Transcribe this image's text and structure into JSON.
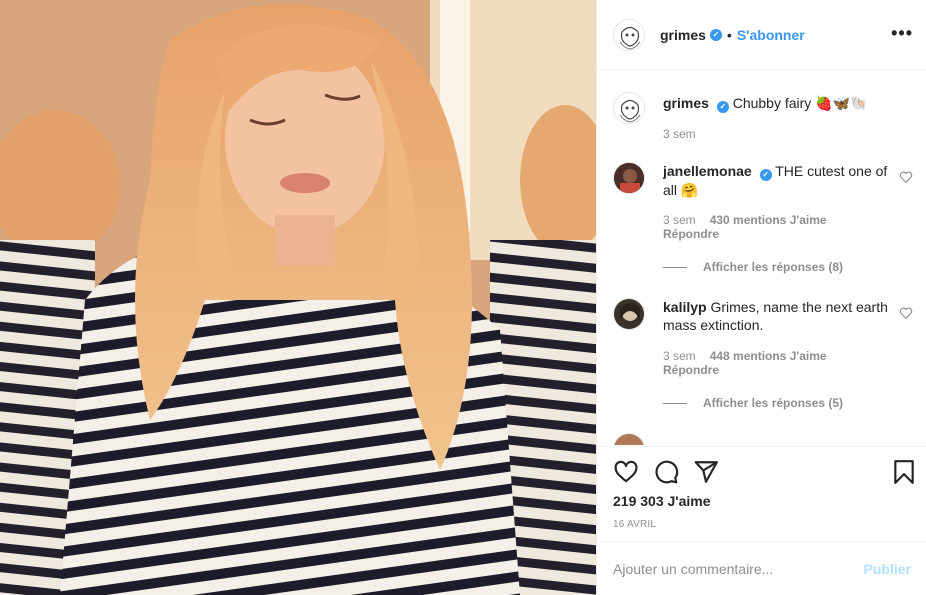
{
  "post": {
    "username": "grimes",
    "follow_label": "S'abonner",
    "separator": "•",
    "more_label": "•••"
  },
  "caption": {
    "username": "grimes",
    "text": "Chubby fairy 🍓🦋🐚",
    "time": "3 sem"
  },
  "comments": [
    {
      "username": "janellemonae",
      "verified": true,
      "text": "THE cutest one of all 🤗",
      "time": "3 sem",
      "likes": "430 mentions J'aime",
      "reply": "Répondre",
      "view_replies": "Afficher les réponses (8)"
    },
    {
      "username": "kalilyp",
      "verified": false,
      "text": "Grimes, name the next earth mass extinction.",
      "time": "3 sem",
      "likes": "448 mentions J'aime",
      "reply": "Répondre",
      "view_replies": "Afficher les réponses (5)"
    }
  ],
  "stats": {
    "likes": "219 303 J'aime",
    "date": "16 AVRIL"
  },
  "composer": {
    "placeholder": "Ajouter un commentaire...",
    "publish_label": "Publier"
  },
  "colors": {
    "accent": "#3897f0",
    "publish_disabled": "#b2dffc",
    "muted": "#8e8e8e"
  },
  "icons": {
    "like": "heart-icon",
    "comment": "comment-icon",
    "share": "share-icon",
    "save": "bookmark-icon",
    "verified": "verified-badge-icon"
  }
}
